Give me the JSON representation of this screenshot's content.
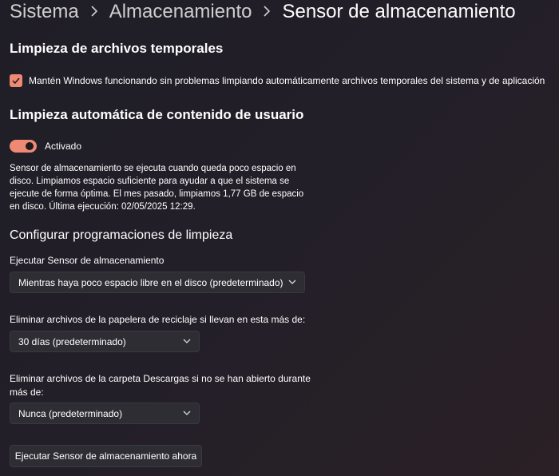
{
  "breadcrumb": {
    "items": [
      "Sistema",
      "Almacenamiento"
    ],
    "current": "Sensor de almacenamiento"
  },
  "temp_cleanup": {
    "title": "Limpieza de archivos temporales",
    "checkbox_label": "Mantén Windows funcionando sin problemas limpiando automáticamente archivos temporales del sistema y de aplicación",
    "checked": true
  },
  "user_cleanup": {
    "title": "Limpieza automática de contenido de usuario",
    "toggle_label": "Activado",
    "toggle_on": true,
    "description": "Sensor de almacenamiento se ejecuta cuando queda poco espacio en disco. Limpiamos espacio suficiente para ayudar a que el sistema se ejecute de forma óptima. El mes pasado, limpiamos 1,77 GB de espacio en disco. Última ejecución: 02/05/2025 12:29."
  },
  "schedules": {
    "title": "Configurar programaciones de limpieza",
    "run_label": "Ejecutar Sensor de almacenamiento",
    "run_value": "Mientras haya poco espacio libre en el disco (predeterminado)",
    "recycle_label": "Eliminar archivos de la papelera de reciclaje si llevan en esta más de:",
    "recycle_value": "30 días (predeterminado)",
    "downloads_label": "Eliminar archivos de la carpeta Descargas si no se han abierto durante más de:",
    "downloads_value": "Nunca (predeterminado)",
    "run_now_button": "Ejecutar Sensor de almacenamiento ahora"
  },
  "colors": {
    "accent": "#ee8a74",
    "background": "#221f28",
    "control": "#2f2d34"
  },
  "icons": {
    "breadcrumb_separator": "chevron-right-icon",
    "checkbox": "checkmark-icon",
    "dropdown": "chevron-down-icon"
  }
}
